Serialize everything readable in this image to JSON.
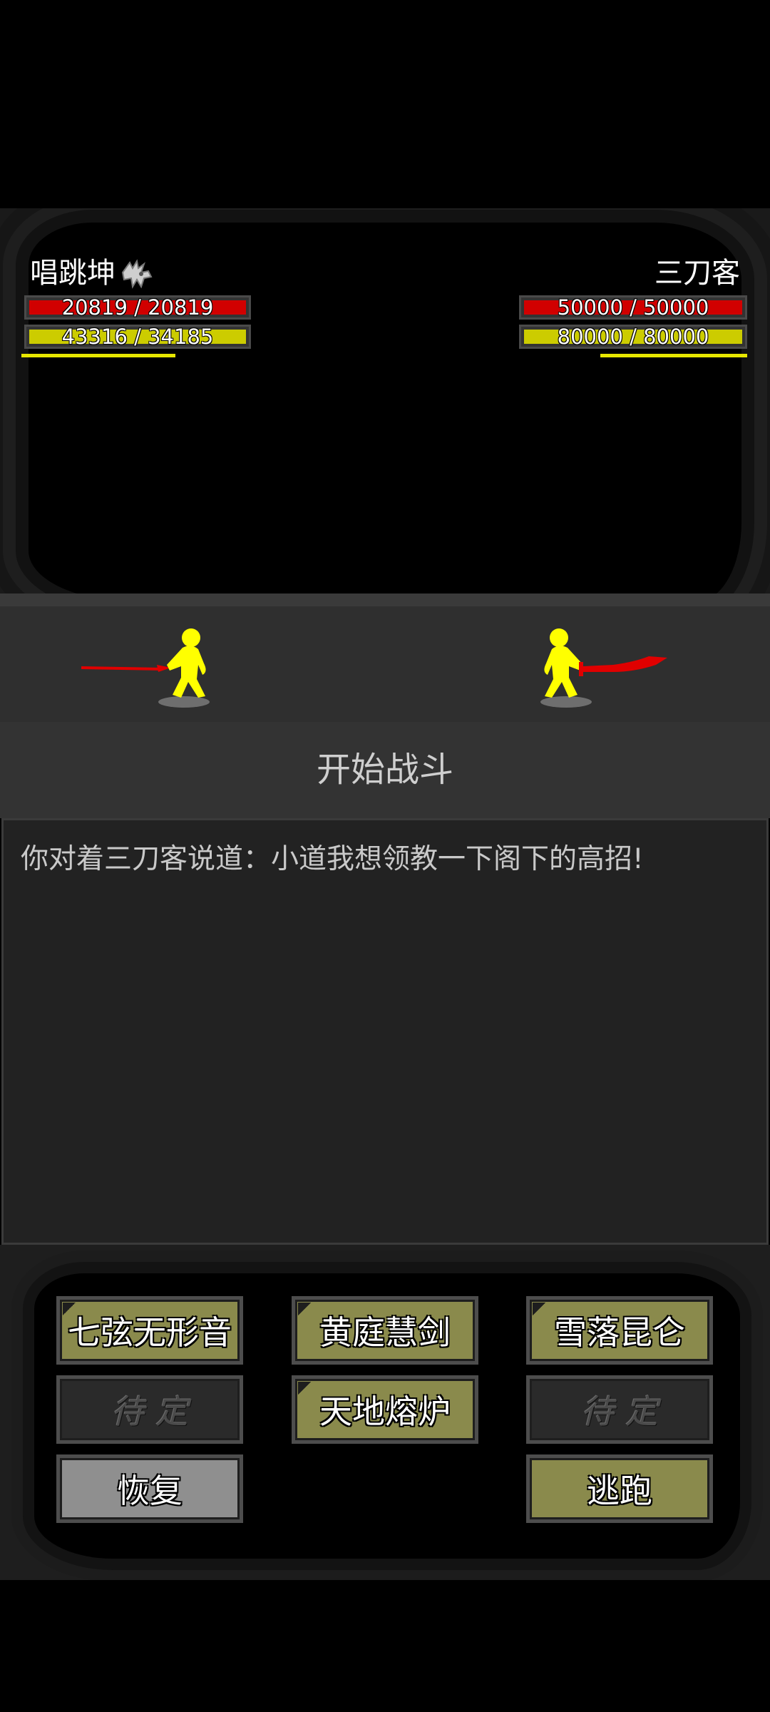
{
  "player": {
    "name": "唱跳坤",
    "emblem_icon": "winged-horse-icon",
    "hp_text": "20819 / 20819",
    "hp_current": 20819,
    "hp_max": 20819,
    "mp_text": "43316 / 34185",
    "mp_current": 43316,
    "mp_max": 34185,
    "weapon": "spear-icon"
  },
  "enemy": {
    "name": "三刀客",
    "hp_text": "50000 / 50000",
    "hp_current": 50000,
    "hp_max": 50000,
    "mp_text": "80000 / 80000",
    "mp_current": 80000,
    "mp_max": 80000,
    "weapon": "saber-icon"
  },
  "battle": {
    "status": "开始战斗"
  },
  "log": {
    "lines": [
      "你对着三刀客说道：小道我想领教一下阁下的高招!"
    ]
  },
  "actions": {
    "skill_1": "七弦无形音",
    "skill_2": "黄庭慧剑",
    "skill_3": "雪落昆仑",
    "skill_4": "待定",
    "skill_5": "天地熔炉",
    "skill_6": "待定",
    "recover": "恢复",
    "flee": "逃跑"
  },
  "colors": {
    "hp": "#d10000",
    "mp": "#cccc00",
    "figure": "#ffff00",
    "weapon": "#e00000",
    "skill_button": "#8a8a4c"
  }
}
